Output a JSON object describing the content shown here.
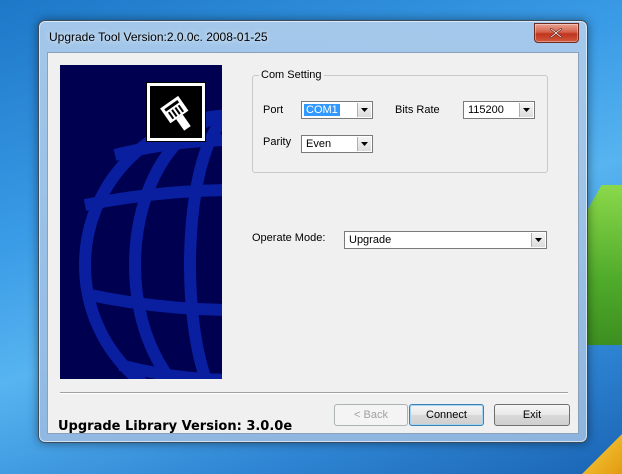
{
  "window": {
    "title": "Upgrade Tool Version:2.0.0c. 2008-01-25"
  },
  "com_setting": {
    "group_label": "Com Setting",
    "port_label": "Port",
    "port_value": "COM1",
    "bits_rate_label": "Bits Rate",
    "bits_rate_value": "115200",
    "parity_label": "Parity",
    "parity_value": "Even"
  },
  "operate": {
    "label": "Operate Mode:",
    "value": "Upgrade"
  },
  "buttons": {
    "back": "< Back",
    "connect": "Connect",
    "exit": "Exit"
  },
  "footer": {
    "library_version": "Upgrade Library Version: 3.0.0e"
  },
  "colors": {
    "banner_bg": "#000050",
    "globe_lines": "#0a1ea0",
    "selection": "#3399ff"
  },
  "icons": {
    "banner_logo": "network-plug-icon",
    "close": "close-icon",
    "dropdown": "chevron-down-icon"
  }
}
